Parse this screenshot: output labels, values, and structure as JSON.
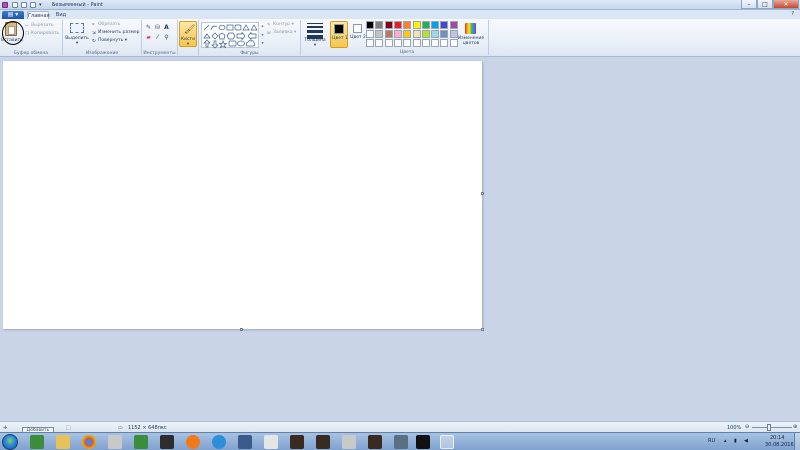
{
  "window": {
    "title": "Безымянный - Paint",
    "controls": {
      "minimize": "–",
      "maximize": "□",
      "close": "✕"
    }
  },
  "tabs": [
    {
      "label": "Главная",
      "active": true
    },
    {
      "label": "Вид",
      "active": false
    }
  ],
  "ribbon": {
    "clipboard": {
      "label": "Буфер обмена",
      "paste": "Вставить",
      "cut": "Вырезать",
      "copy": "Копировать"
    },
    "image": {
      "label": "Изображение",
      "select": "Выделить",
      "crop": "Обрезать",
      "resize": "Изменить размер",
      "rotate": "Повернуть ▾"
    },
    "tools": {
      "label": "Инструменты"
    },
    "brushes": {
      "label": "Кисти"
    },
    "shapes": {
      "label": "Фигуры",
      "outline": "Контур ▾",
      "fill": "Заливка ▾"
    },
    "size": {
      "label": "Толщина"
    },
    "colors": {
      "label": "Цвета",
      "color1": "Цвет 1",
      "color2": "Цвет 2",
      "edit": "Изменение цветов",
      "color1_value": "#000000",
      "color2_value": "#ffffff",
      "palette": [
        "#000000",
        "#7f7f7f",
        "#880015",
        "#ed1c24",
        "#ff7f27",
        "#fff200",
        "#22b14c",
        "#00a2e8",
        "#3f48cc",
        "#a349a4",
        "#ffffff",
        "#c3c3c3",
        "#b97a57",
        "#ffaec9",
        "#ffc90e",
        "#efe4b0",
        "#b5e61d",
        "#99d9ea",
        "#7092be",
        "#c8bfe7",
        "#ffffff",
        "#ffffff",
        "#ffffff",
        "#ffffff",
        "#ffffff",
        "#ffffff",
        "#ffffff",
        "#ffffff",
        "#ffffff",
        "#ffffff"
      ]
    }
  },
  "status": {
    "tooltip": "Добавить",
    "canvas_size": "1152 × 648пкс",
    "zoom": "100%"
  },
  "tray": {
    "lang": "RU",
    "time": "20:14",
    "date": "30.08.2016"
  }
}
